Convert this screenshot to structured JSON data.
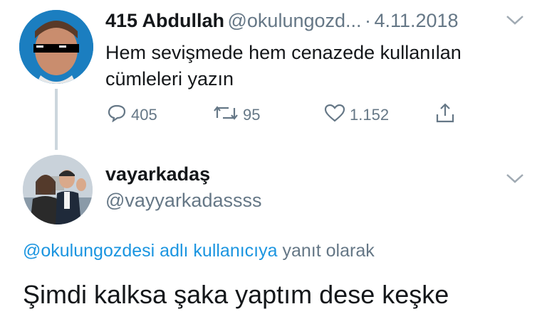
{
  "tweet": {
    "author_name": "415 Abdullah",
    "author_handle": "@okulungozd...",
    "separator": "·",
    "date": "4.11.2018",
    "text_line1": "Hem sevişmede hem cenazede kullanılan",
    "text_line2": "cümleleri yazın",
    "actions": {
      "replies": "405",
      "retweets": "95",
      "likes": "1.152"
    }
  },
  "reply": {
    "author_name": "vayarkadaş",
    "author_handle": "@vayyarkadassss",
    "replying_to_handle": "@okulungozdesi adlı kullanıcıya",
    "replying_to_suffix": "yanıt olarak",
    "text": "Şimdi kalksa şaka yaptım dese keşke"
  },
  "colors": {
    "link": "#1b95e0",
    "muted": "#657786",
    "thread_line": "#ccd6dd"
  },
  "icons": [
    "reply-icon",
    "retweet-icon",
    "like-icon",
    "share-icon",
    "chevron-down-icon"
  ]
}
